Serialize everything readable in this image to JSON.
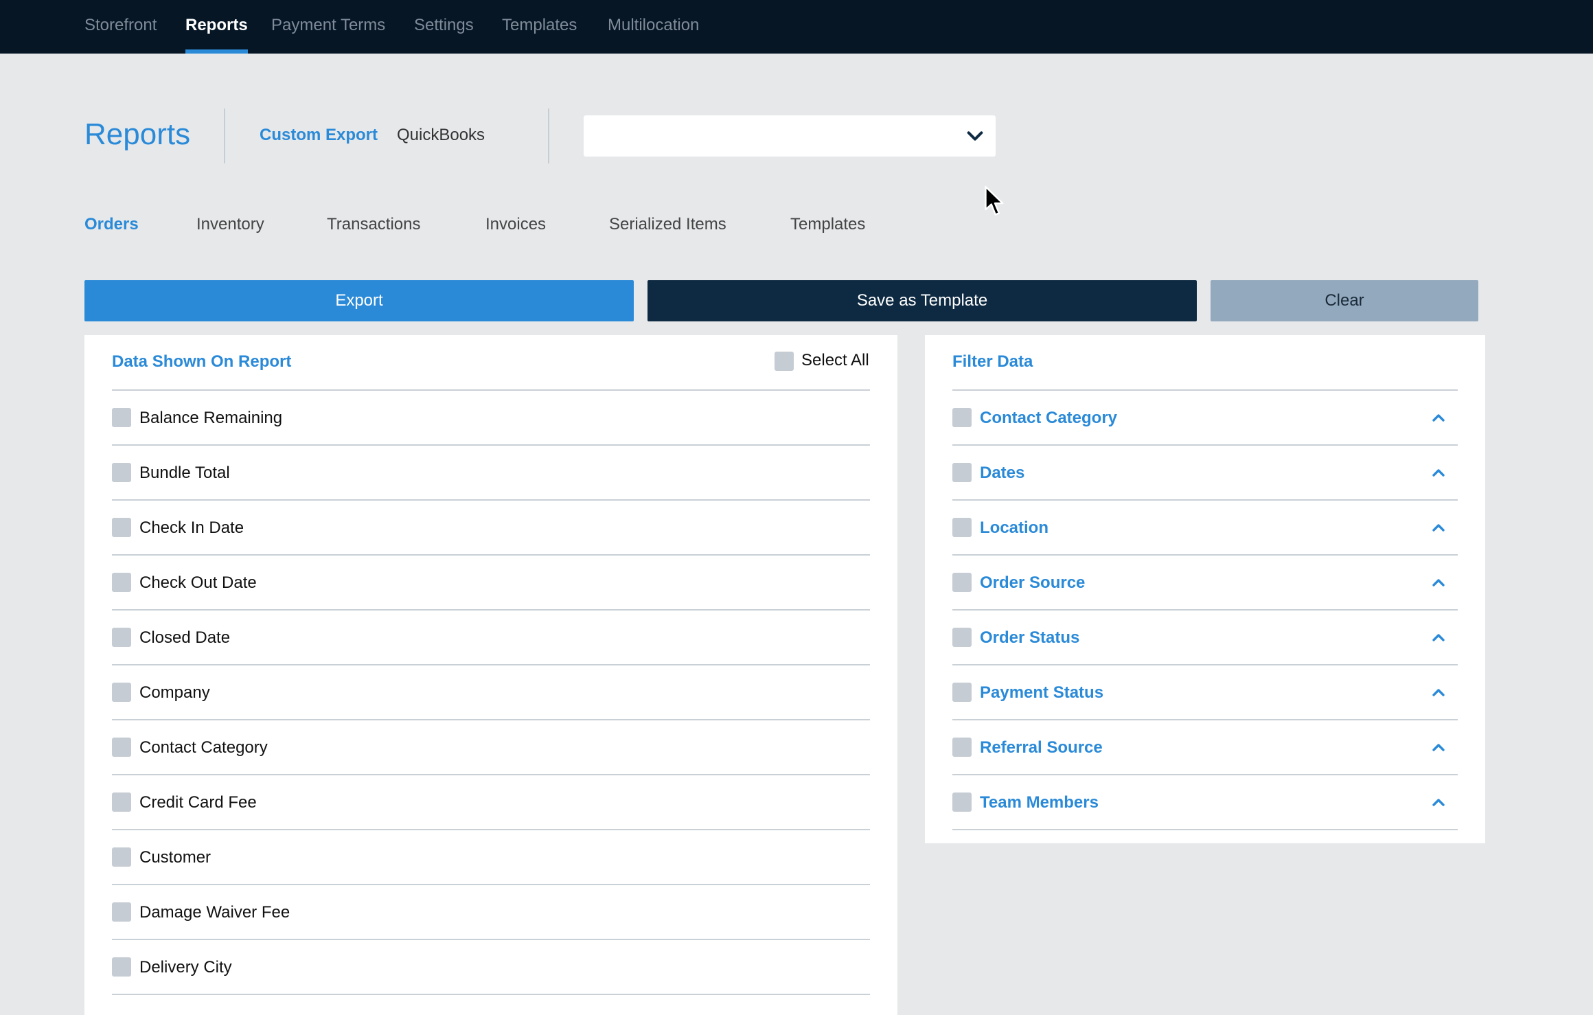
{
  "topnav": {
    "items": [
      {
        "label": "Storefront",
        "active": false
      },
      {
        "label": "Reports",
        "active": true
      },
      {
        "label": "Payment Terms",
        "active": false
      },
      {
        "label": "Settings",
        "active": false
      },
      {
        "label": "Templates",
        "active": false
      },
      {
        "label": "Multilocation",
        "active": false
      }
    ]
  },
  "header": {
    "title": "Reports",
    "subtabs": [
      {
        "label": "Custom Export",
        "active": true
      },
      {
        "label": "QuickBooks",
        "active": false
      }
    ],
    "template_select": {
      "value": "",
      "icon": "chevron-down-icon"
    }
  },
  "data_tabs": [
    {
      "label": "Orders",
      "active": true
    },
    {
      "label": "Inventory",
      "active": false
    },
    {
      "label": "Transactions",
      "active": false
    },
    {
      "label": "Invoices",
      "active": false
    },
    {
      "label": "Serialized Items",
      "active": false
    },
    {
      "label": "Templates",
      "active": false
    }
  ],
  "actions": {
    "export_label": "Export",
    "save_template_label": "Save as Template",
    "clear_label": "Clear"
  },
  "data_panel": {
    "heading": "Data Shown On Report",
    "select_all_label": "Select All",
    "fields": [
      {
        "label": "Balance Remaining",
        "checked": false
      },
      {
        "label": "Bundle Total",
        "checked": false
      },
      {
        "label": "Check In Date",
        "checked": false
      },
      {
        "label": "Check Out Date",
        "checked": false
      },
      {
        "label": "Closed Date",
        "checked": false
      },
      {
        "label": "Company",
        "checked": false
      },
      {
        "label": "Contact Category",
        "checked": false
      },
      {
        "label": "Credit Card Fee",
        "checked": false
      },
      {
        "label": "Customer",
        "checked": false
      },
      {
        "label": "Damage Waiver Fee",
        "checked": false
      },
      {
        "label": "Delivery City",
        "checked": false
      }
    ]
  },
  "filter_panel": {
    "heading": "Filter Data",
    "filters": [
      {
        "label": "Contact Category",
        "checked": false,
        "icon": "chevron-up-icon"
      },
      {
        "label": "Dates",
        "checked": false,
        "icon": "chevron-up-icon"
      },
      {
        "label": "Location",
        "checked": false,
        "icon": "chevron-up-icon"
      },
      {
        "label": "Order Source",
        "checked": false,
        "icon": "chevron-up-icon"
      },
      {
        "label": "Order Status",
        "checked": false,
        "icon": "chevron-up-icon"
      },
      {
        "label": "Payment Status",
        "checked": false,
        "icon": "chevron-up-icon"
      },
      {
        "label": "Referral Source",
        "checked": false,
        "icon": "chevron-up-icon"
      },
      {
        "label": "Team Members",
        "checked": false,
        "icon": "chevron-up-icon"
      }
    ]
  },
  "colors": {
    "nav_bg": "#061625",
    "accent": "#2a8ad8",
    "dark_button": "#0e2a42",
    "clear_button": "#93a9bd",
    "page_bg": "#e6e8ea",
    "checkbox": "#c6ccd3"
  }
}
